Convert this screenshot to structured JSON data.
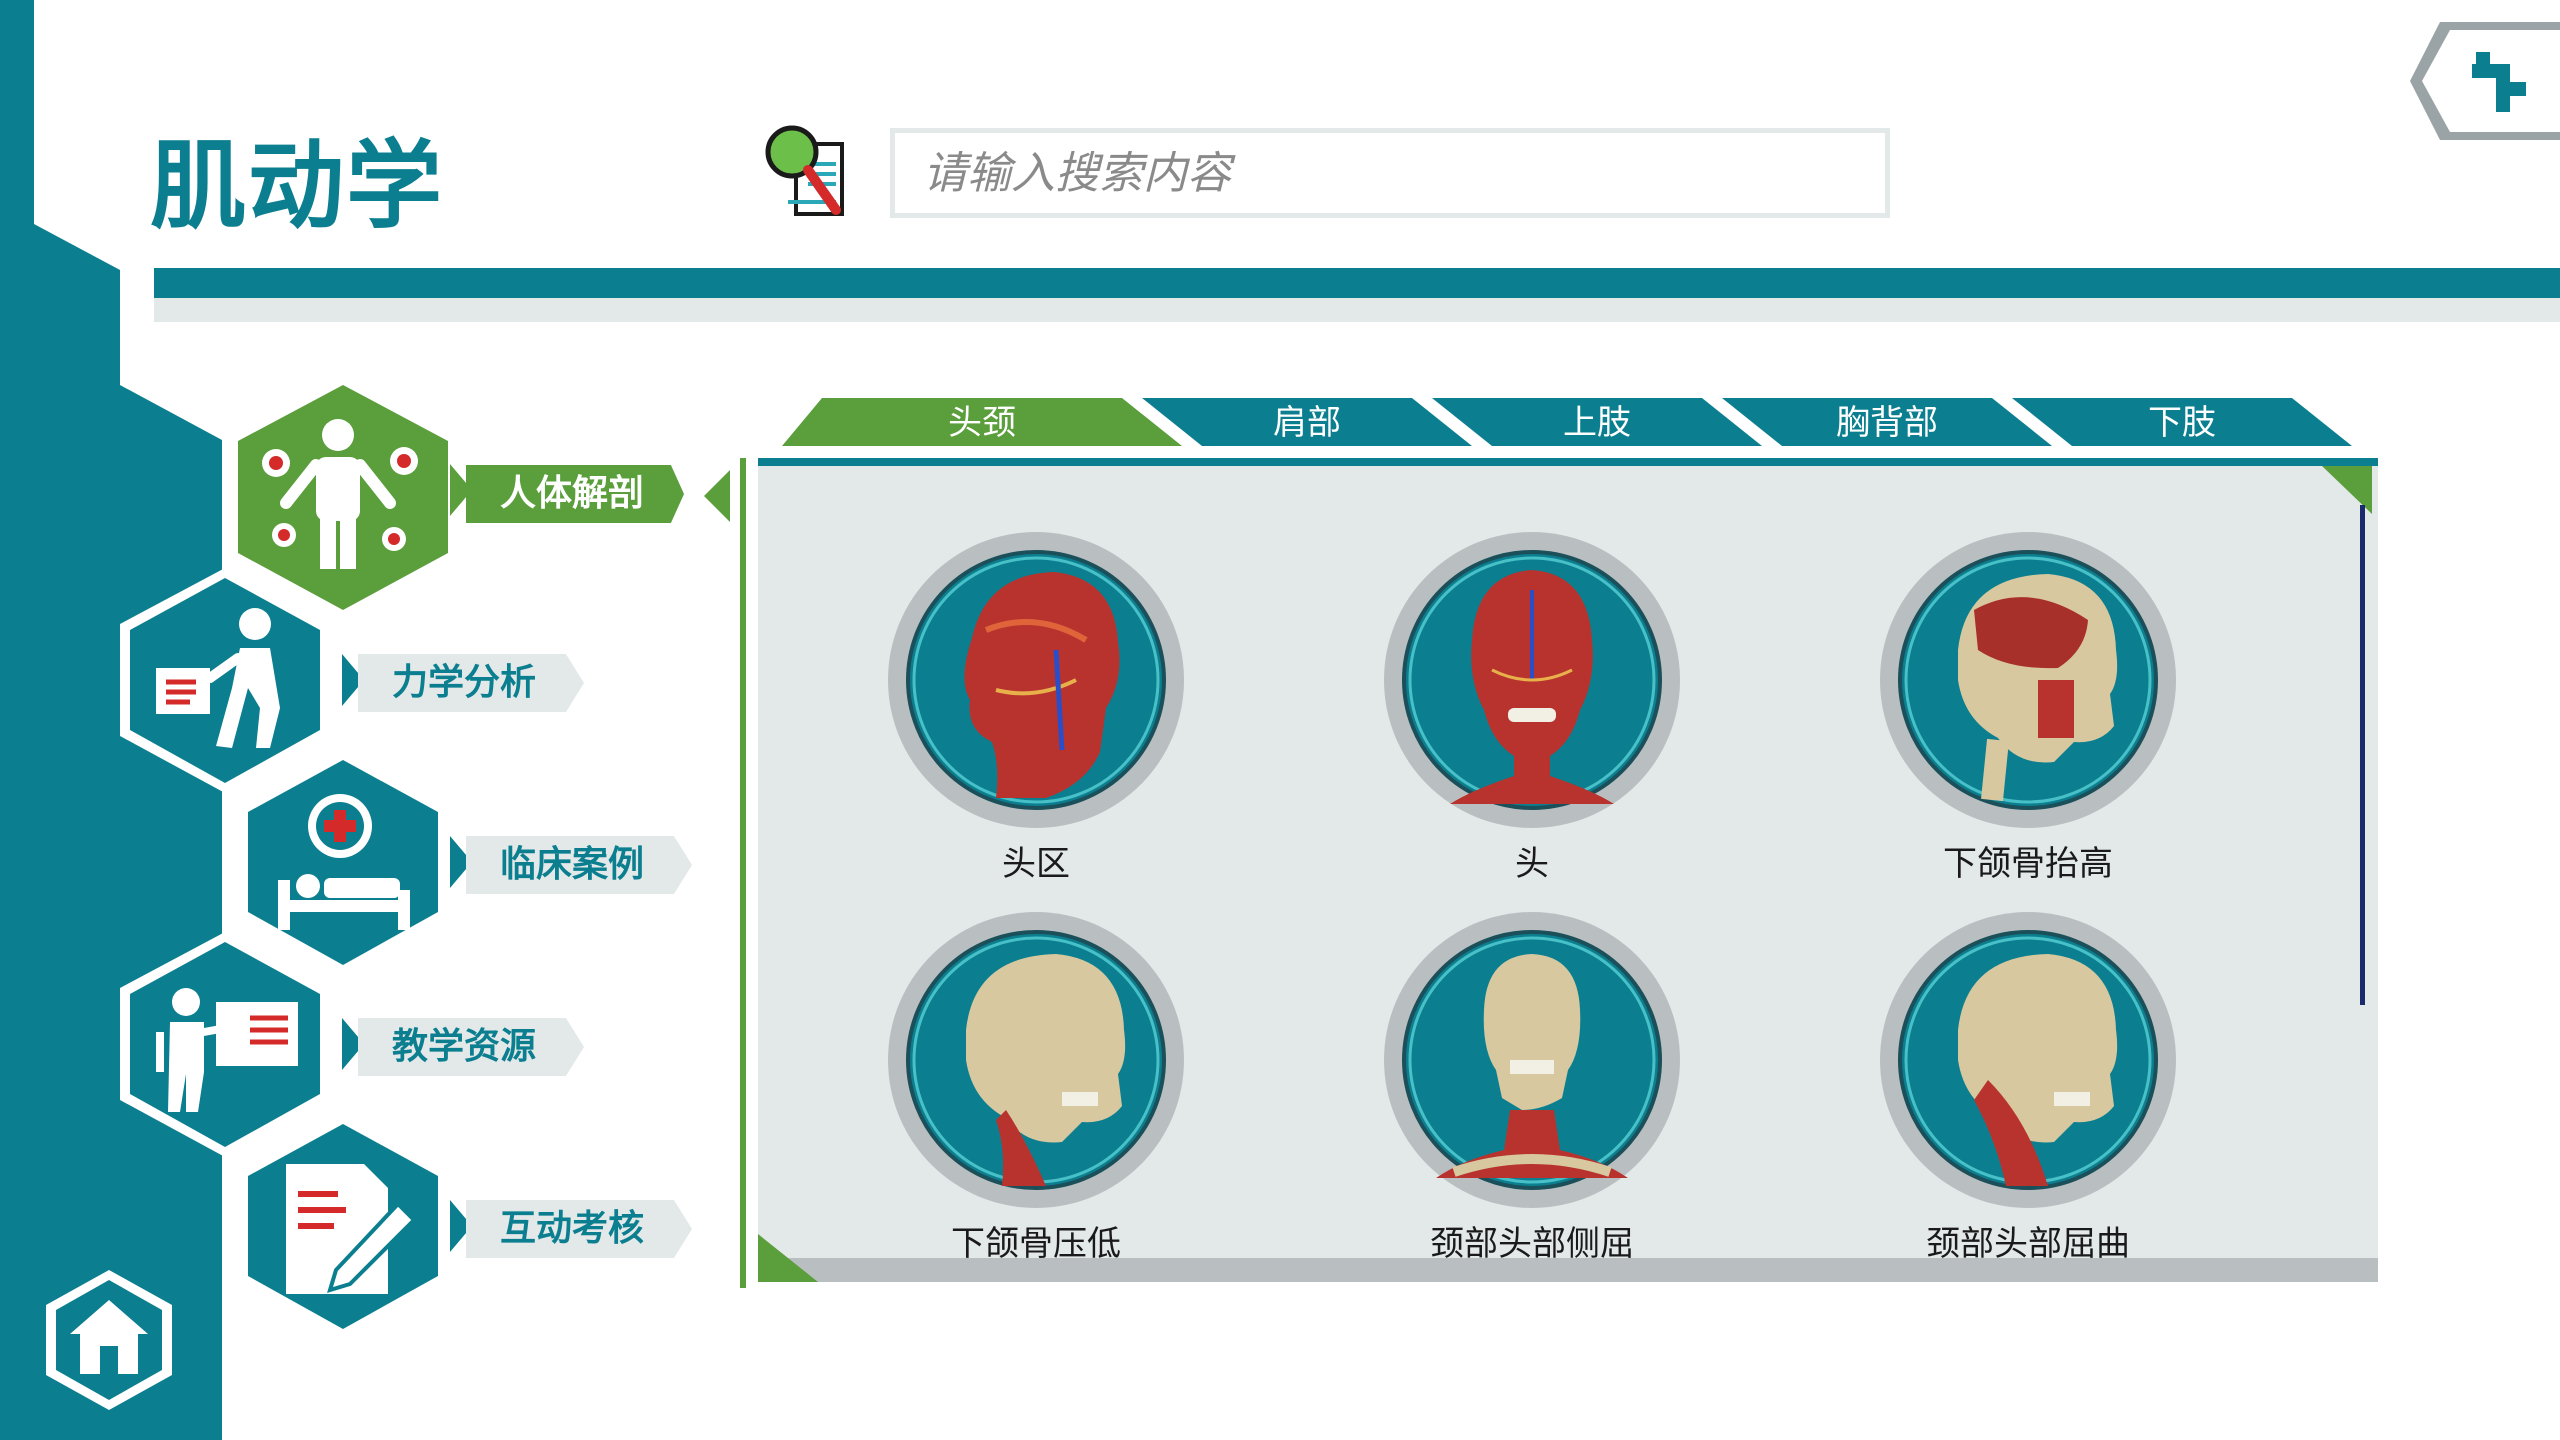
{
  "header": {
    "title": "肌动学",
    "search_placeholder": "请输入搜索内容"
  },
  "nav": {
    "items": [
      {
        "label": "人体解剖",
        "icon": "human-anatomy-icon",
        "active": true
      },
      {
        "label": "力学分析",
        "icon": "mechanics-analysis-icon",
        "active": false
      },
      {
        "label": "临床案例",
        "icon": "clinical-case-icon",
        "active": false
      },
      {
        "label": "教学资源",
        "icon": "teaching-resources-icon",
        "active": false
      },
      {
        "label": "互动考核",
        "icon": "interactive-assessment-icon",
        "active": false
      }
    ]
  },
  "tabs": [
    {
      "label": "头颈",
      "active": true
    },
    {
      "label": "肩部",
      "active": false
    },
    {
      "label": "上肢",
      "active": false
    },
    {
      "label": "胸背部",
      "active": false
    },
    {
      "label": "下肢",
      "active": false
    }
  ],
  "cards": [
    {
      "label": "头区",
      "icon": "head-muscles-side-icon"
    },
    {
      "label": "头",
      "icon": "head-muscles-front-icon"
    },
    {
      "label": "下颌骨抬高",
      "icon": "skull-masseter-icon"
    },
    {
      "label": "下颌骨压低",
      "icon": "skull-neck-muscles-icon"
    },
    {
      "label": "颈部头部侧屈",
      "icon": "skull-front-neck-icon"
    },
    {
      "label": "颈部头部屈曲",
      "icon": "skull-neck-flexion-icon"
    }
  ],
  "colors": {
    "teal": "#0b7f8f",
    "green": "#5b9e3c",
    "light_grey": "#e3e8e9",
    "red": "#d42a2a"
  }
}
